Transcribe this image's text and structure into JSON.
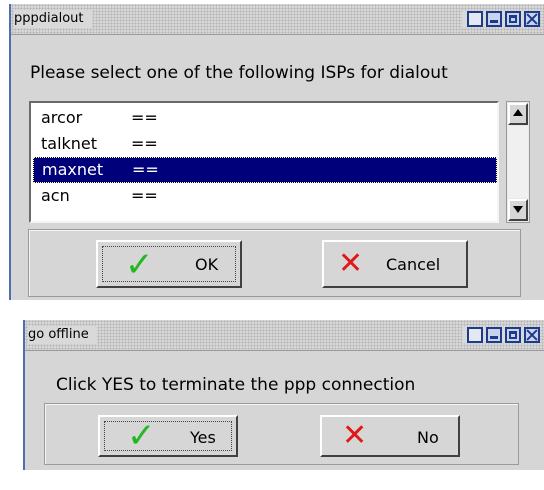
{
  "dialout_window": {
    "title": "pppdialout",
    "prompt": "Please select one of the following ISPs for dialout",
    "isp_list": [
      {
        "name": "arcor",
        "separator": "==",
        "selected": false
      },
      {
        "name": "talknet",
        "separator": "==",
        "selected": false
      },
      {
        "name": "maxnet",
        "separator": "==",
        "selected": true
      },
      {
        "name": "acn",
        "separator": "==",
        "selected": false
      }
    ],
    "ok_label": "OK",
    "cancel_label": "Cancel",
    "ok_icon": "check-icon",
    "cancel_icon": "cross-icon"
  },
  "offline_window": {
    "title": "go offline",
    "prompt": "Click YES to terminate the ppp connection",
    "yes_label": "Yes",
    "no_label": "No",
    "yes_icon": "check-icon",
    "no_icon": "cross-icon"
  },
  "colors": {
    "window_bg": "#d6d6d6",
    "selection_bg": "#00007b",
    "check": "#21b821",
    "cross": "#e01818",
    "titlebar_buttons": "#1e3a8a"
  }
}
